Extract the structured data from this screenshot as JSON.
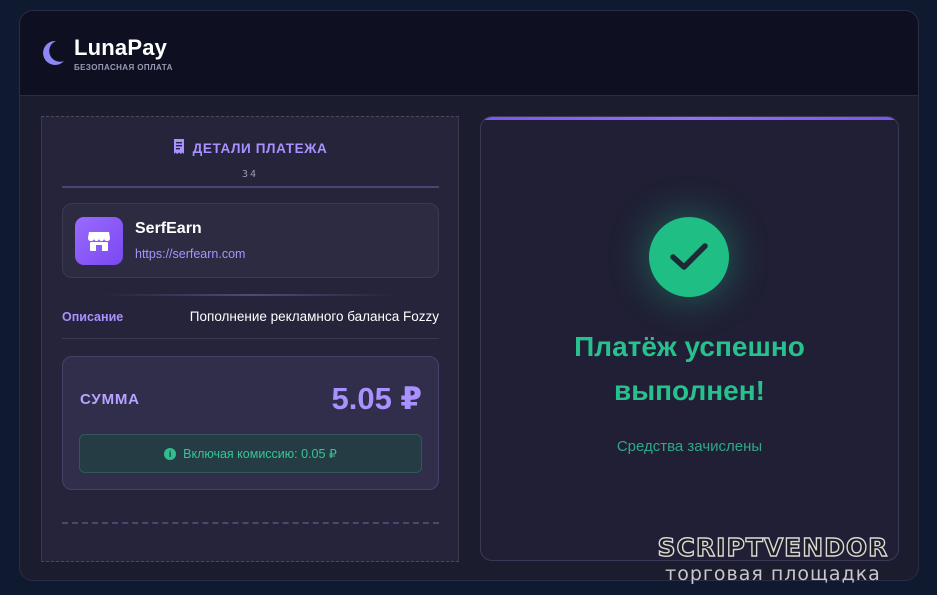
{
  "header": {
    "brand_name": "LunaPay",
    "brand_tagline": "БЕЗОПАСНАЯ ОПЛАТА",
    "logo_icon": "moon-icon"
  },
  "receipt": {
    "title": "ДЕТАЛИ ПЛАТЕЖА",
    "title_icon": "receipt-icon",
    "number": "34",
    "merchant": {
      "name": "SerfEarn",
      "url": "https://serfearn.com",
      "icon": "store-icon"
    },
    "description_label": "Описание",
    "description_value": "Пополнение рекламного баланса Fozzy",
    "amount_label": "СУММА",
    "amount_value": "5.05 ₽",
    "fee_text": "Включая комиссию: 0.05 ₽",
    "fee_icon": "info-icon"
  },
  "success": {
    "icon": "checkmark-icon",
    "title_line1": "Платёж успешно",
    "title_line2": "выполнен!",
    "subtitle": "Средства зачислены"
  },
  "watermark": {
    "main": "SCRIPTVENDOR",
    "sub": "торговая площадка"
  },
  "colors": {
    "accent": "#a992ff",
    "success": "#1fbe85",
    "background": "#0f1a30"
  }
}
